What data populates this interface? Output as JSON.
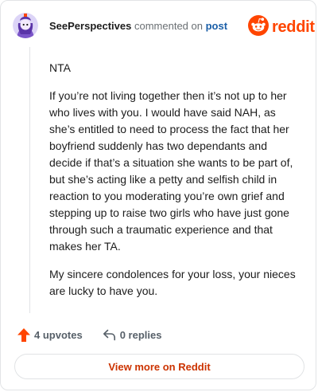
{
  "comment": {
    "author": "SeePerspectives",
    "action_text": "commented on",
    "post_link": "post",
    "paragraphs": [
      "NTA",
      "If you’re not living together then it’s not up to her who lives with you. I would have said NAH, as she’s entitled to need to process the fact that her boyfriend suddenly has two dependants and decide if that’s a situation she wants to be part of, but she’s acting like a petty and selfish child in reaction to you moderating you’re own grief and stepping up to raise two girls who have just gone through such a traumatic experience and that makes her TA.",
      "My sincere condolences for your loss, your nieces are lucky to have you."
    ]
  },
  "brand": {
    "name": "reddit",
    "logo_icon": "reddit-snoo-icon",
    "color": "#ff4500"
  },
  "actions": {
    "upvotes": "4 upvotes",
    "replies": "0 replies",
    "upvote_icon": "upvote-arrow-icon",
    "reply_icon": "reply-arrow-icon",
    "upvote_color": "#ff4500"
  },
  "footer": {
    "view_more_label": "View more on Reddit",
    "link_color": "#cc3300"
  }
}
